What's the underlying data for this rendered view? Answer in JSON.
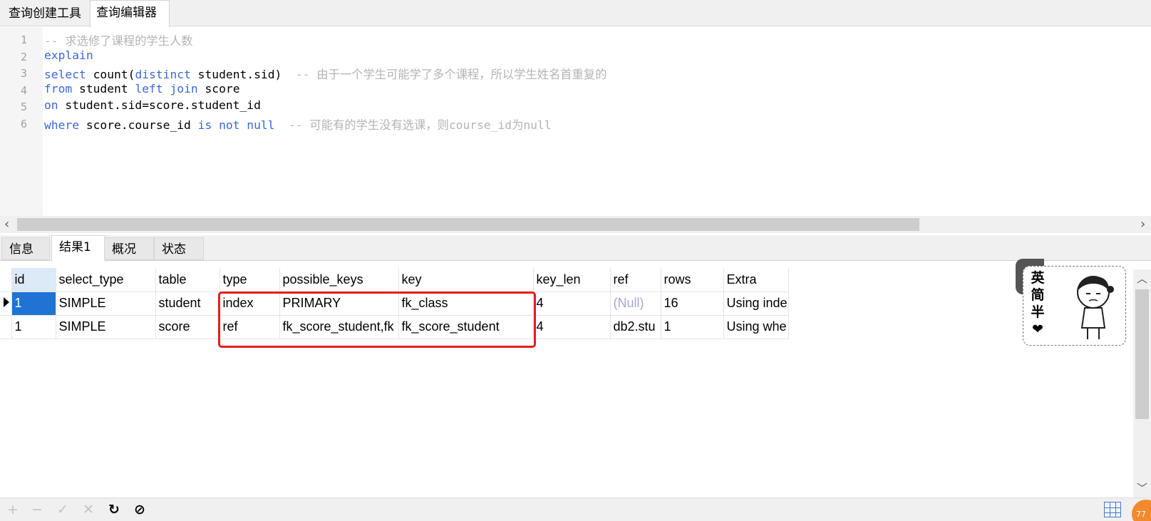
{
  "top_tabs": [
    "查询创建工具",
    "查询编辑器"
  ],
  "editor": {
    "line_numbers": [
      "1",
      "2",
      "3",
      "4",
      "5",
      "6"
    ],
    "line1": {
      "comment": "-- 求选修了课程的学生人数"
    },
    "line2": {
      "kw": "explain"
    },
    "line3": {
      "kw1": "select",
      "t1": " count(",
      "kw2": "distinct",
      "t2": " student.sid)  ",
      "comment": "-- 由于一个学生可能学了多个课程，所以学生姓名首重复的"
    },
    "line4": {
      "kw1": "from",
      "t1": " student ",
      "kw2": "left join",
      "t2": " score"
    },
    "line5": {
      "kw1": "on",
      "t1": " student.sid=score.student_id"
    },
    "line6": {
      "kw1": "where",
      "t1": " score.course_id ",
      "kw2": "is not null",
      "t2": "  ",
      "comment": "-- 可能有的学生没有选课，则course_id为null"
    }
  },
  "result_tabs": [
    "信息",
    "结果1",
    "概况",
    "状态"
  ],
  "columns": [
    "id",
    "select_type",
    "table",
    "type",
    "possible_keys",
    "key",
    "key_len",
    "ref",
    "rows",
    "Extra"
  ],
  "rows": [
    [
      "1",
      "SIMPLE",
      "student",
      "index",
      "PRIMARY",
      "fk_class",
      "4",
      "(Null)",
      "16",
      "Using inde"
    ],
    [
      "1",
      "SIMPLE",
      "score",
      "ref",
      "fk_score_student,fk",
      "fk_score_student",
      "4",
      "db2.stu",
      "1",
      "Using whe"
    ]
  ],
  "sticker": {
    "text": [
      "英",
      "简",
      "半",
      "❤"
    ]
  },
  "bottom_toolbar": {
    "add": "+",
    "remove": "−",
    "apply": "✓",
    "discard": "✕",
    "refresh": "↻",
    "stop": "⊘"
  },
  "badge": "77",
  "colors": {
    "keyword": "#3b67d8",
    "comment": "#b4b4b4",
    "highlight": "#e31d1d",
    "selection": "#1f73d4"
  }
}
